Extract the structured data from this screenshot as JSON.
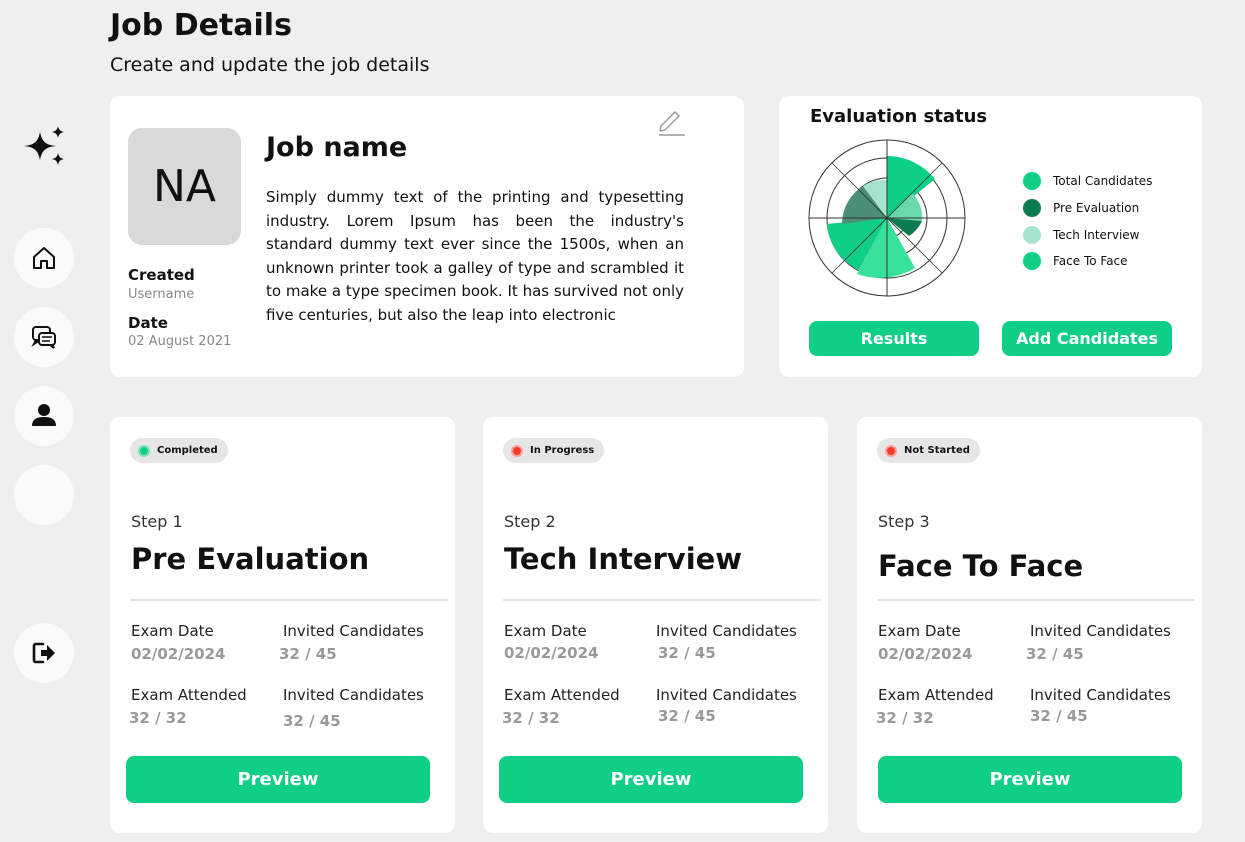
{
  "header": {
    "title": "Job Details",
    "subtitle": "Create and update the job details"
  },
  "sidebar": {
    "items": [
      {
        "icon": "sparkle-icon"
      },
      {
        "icon": "home-icon"
      },
      {
        "icon": "chat-icon"
      },
      {
        "icon": "user-icon"
      },
      {
        "icon": "empty"
      },
      {
        "icon": "logout-icon"
      }
    ]
  },
  "job": {
    "initials": "NA",
    "name": "Job name",
    "description": "Simply dummy text of the printing and typesetting industry. Lorem Ipsum has been the industry's standard dummy text ever since the 1500s, when an unknown printer took a galley of type and scrambled it to make a type specimen book. It has survived not only five centuries, but also the leap into electronic",
    "created_label": "Created",
    "created_value": "Username",
    "date_label": "Date",
    "date_value": "02 August 2021"
  },
  "evaluation": {
    "title": "Evaluation status",
    "legend": [
      {
        "label": "Total Candidates",
        "color": "#0ecf85"
      },
      {
        "label": "Pre Evaluation",
        "color": "#0d7a4f"
      },
      {
        "label": "Tech Interview",
        "color": "#a6e3cc"
      },
      {
        "label": "Face To Face",
        "color": "#0ecf85"
      }
    ],
    "results_label": "Results",
    "add_label": "Add Candidates"
  },
  "steps": [
    {
      "status": "Completed",
      "status_color": "#0ecf85",
      "step": "Step 1",
      "name": "Pre Evaluation",
      "exam_date_label": "Exam Date",
      "exam_date": "02/02/2024",
      "invited_label_1": "Invited Candidates",
      "invited_1": "32 / 45",
      "attended_label": "Exam Attended",
      "attended": "32 / 32",
      "invited_label_2": "Invited Candidates",
      "invited_2": "32 / 45",
      "preview_label": "Preview"
    },
    {
      "status": "In Progress",
      "status_color": "#f53b2a",
      "step": "Step 2",
      "name": "Tech Interview",
      "exam_date_label": "Exam Date",
      "exam_date": "02/02/2024",
      "invited_label_1": "Invited Candidates",
      "invited_1": "32 / 45",
      "attended_label": "Exam Attended",
      "attended": "32 / 32",
      "invited_label_2": "Invited Candidates",
      "invited_2": "32 / 45",
      "preview_label": "Preview"
    },
    {
      "status": "Not Started",
      "status_color": "#f53b2a",
      "step": "Step 3",
      "name": "Face To Face",
      "exam_date_label": "Exam Date",
      "exam_date": "02/02/2024",
      "invited_label_1": "Invited Candidates",
      "invited_1": "32 / 45",
      "attended_label": "Exam Attended",
      "attended": "32 / 32",
      "invited_label_2": "Invited Candidates",
      "invited_2": "32 / 45",
      "preview_label": "Preview"
    }
  ]
}
